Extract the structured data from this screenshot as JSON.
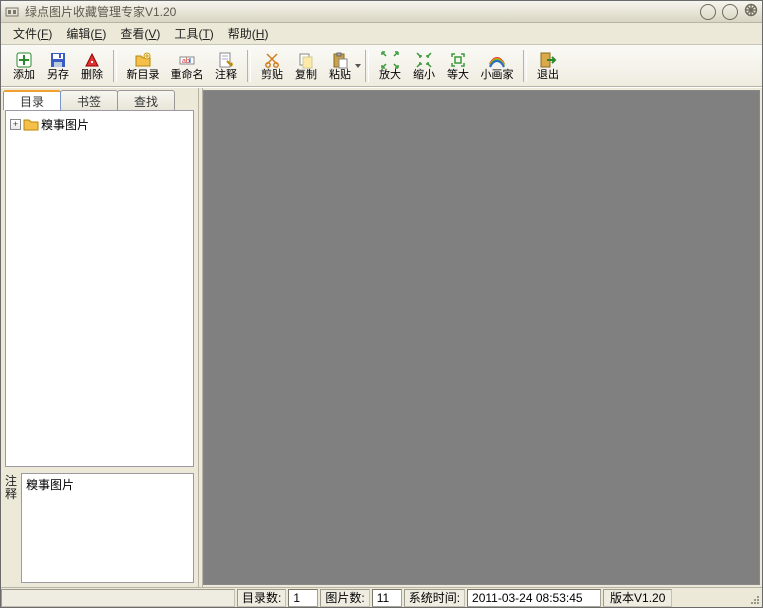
{
  "window": {
    "title": "绿点图片收藏管理专家V1.20"
  },
  "menu": {
    "file": {
      "label": "文件",
      "key": "F"
    },
    "edit": {
      "label": "编辑",
      "key": "E"
    },
    "view": {
      "label": "查看",
      "key": "V"
    },
    "tool": {
      "label": "工具",
      "key": "T"
    },
    "help": {
      "label": "帮助",
      "key": "H"
    }
  },
  "toolbar": {
    "add": "添加",
    "saveas": "另存",
    "delete": "删除",
    "newdir": "新目录",
    "rename": "重命名",
    "annotate": "注释",
    "cut": "剪贴",
    "copy": "复制",
    "paste": "粘贴",
    "zoomin": "放大",
    "zoomout": "缩小",
    "zoomeq": "等大",
    "painter": "小画家",
    "exit": "退出"
  },
  "sidebar": {
    "tabs": {
      "dir": "目录",
      "bookmark": "书签",
      "search": "查找"
    },
    "tree": {
      "root_label": "糗事图片"
    },
    "notes_label": "注\n释",
    "notes_value": "糗事图片"
  },
  "status": {
    "dir_label": "目录数:",
    "dir_value": "1",
    "img_label": "图片数:",
    "img_value": "11",
    "time_label": "系统时间:",
    "time_value": "2011-03-24 08:53:45",
    "version": "版本V1.20"
  }
}
